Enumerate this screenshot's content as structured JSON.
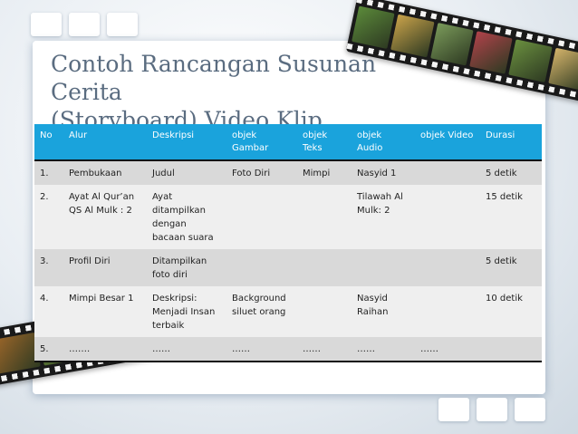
{
  "slide": {
    "title_line1": "Contoh Rancangan Susunan Cerita",
    "title_line2": "(Storyboard) Video Klip"
  },
  "table": {
    "headers": [
      "No",
      "Alur",
      "Deskripsi",
      "objek Gambar",
      "objek Teks",
      "objek Audio",
      "objek Video",
      "Durasi"
    ],
    "rows": [
      [
        "1.",
        "Pembukaan",
        "Judul",
        "Foto Diri",
        "Mimpi",
        "Nasyid 1",
        "",
        "5 detik"
      ],
      [
        "2.",
        "Ayat Al Qur’an QS Al Mulk : 2",
        "Ayat ditampilkan dengan bacaan suara",
        "",
        "",
        "Tilawah Al Mulk: 2",
        "",
        "15 detik"
      ],
      [
        "3.",
        "Profil Diri",
        "Ditampilkan foto diri",
        "",
        "",
        "",
        "",
        "5 detik"
      ],
      [
        "4.",
        "Mimpi Besar 1",
        "Deskripsi: Menjadi Insan terbaik",
        "Background siluet orang",
        "",
        "Nasyid Raihan",
        "",
        "10 detik"
      ],
      [
        "5.",
        "…….",
        "……",
        "……",
        "……",
        "……",
        "……",
        ""
      ]
    ]
  },
  "colors": {
    "header_bg": "#1aa3dc",
    "row_odd": "#d9d9d9",
    "row_even": "#efefef",
    "title_color": "#5a6c80"
  },
  "decor": {
    "film_top_cells": [
      "#5b8a3a",
      "#c9a24a",
      "#7a9a5a",
      "#b0424a",
      "#6a8f3f",
      "#d4b36a"
    ],
    "film_bottom_cells": [
      "#a66a2a",
      "#6b8e3c",
      "#d9c06a",
      "#5a7f3a"
    ]
  }
}
